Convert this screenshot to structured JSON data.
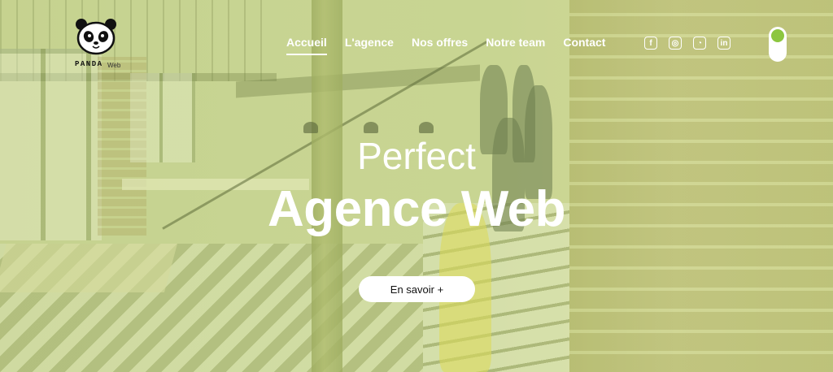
{
  "logo": {
    "brand": "PANDA",
    "brand_sub": "Web"
  },
  "nav": {
    "items": [
      {
        "label": "Accueil",
        "active": true
      },
      {
        "label": "L'agence",
        "active": false
      },
      {
        "label": "Nos offres",
        "active": false
      },
      {
        "label": "Notre team",
        "active": false
      },
      {
        "label": "Contact",
        "active": false
      }
    ]
  },
  "socials": [
    {
      "icon": "facebook-icon",
      "glyph": "f"
    },
    {
      "icon": "instagram-icon",
      "glyph": "◎"
    },
    {
      "icon": "github-icon",
      "glyph": "◔"
    },
    {
      "icon": "linkedin-icon",
      "glyph": "in"
    }
  ],
  "theme_toggle": {
    "knob_color": "#8cc63f"
  },
  "hero": {
    "subtitle": "Perfect",
    "title": "Agence Web",
    "cta_label": "En savoir +"
  },
  "colors": {
    "overlay": "#c3d778",
    "accent": "#8cc63f",
    "text": "#ffffff"
  }
}
